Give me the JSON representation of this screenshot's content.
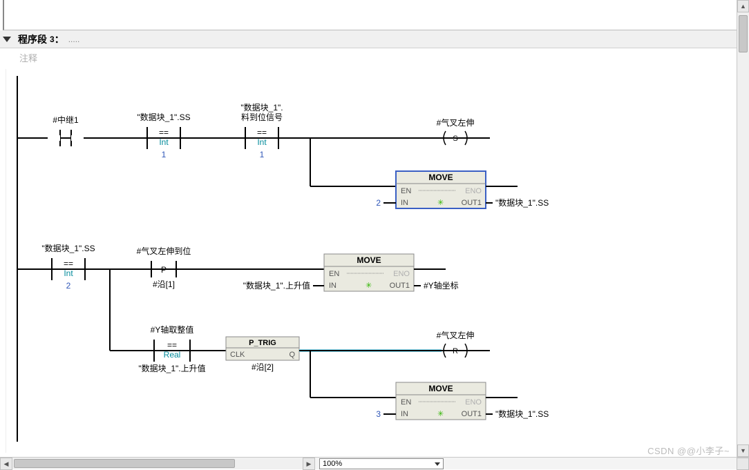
{
  "section": {
    "prefix": "程序段",
    "number": "3",
    "colon": "：",
    "dots": ".....",
    "comment_placeholder": "注释"
  },
  "rung1": {
    "contact1": "#中继1",
    "cmp1": {
      "top": "\"数据块_1\".SS",
      "type": "==",
      "datatype": "Int",
      "value": "1"
    },
    "cmp2": {
      "top_l1": "\"数据块_1\".",
      "top_l2": "料到位信号",
      "type": "==",
      "datatype": "Int",
      "value": "1"
    },
    "coil": {
      "label": "#气叉左伸",
      "letter": "S"
    },
    "move": {
      "title": "MOVE",
      "en": "EN",
      "eno": "ENO",
      "in": "IN",
      "out": "OUT1",
      "in_val": "2",
      "out_tag": "\"数据块_1\".SS"
    }
  },
  "rung2": {
    "cmp": {
      "top": "\"数据块_1\".SS",
      "type": "==",
      "datatype": "Int",
      "value": "2"
    },
    "pcontact": {
      "top": "#气叉左伸到位",
      "letter": "P",
      "bottom": "#沿[1]"
    },
    "move": {
      "title": "MOVE",
      "en": "EN",
      "eno": "ENO",
      "in": "IN",
      "out": "OUT1",
      "in_tag": "\"数据块_1\".上升值",
      "out_tag": "#Y轴坐标"
    }
  },
  "rung3": {
    "cmp_real": {
      "top": "#Y轴取整值",
      "type": "==",
      "datatype": "Real",
      "bottom": "\"数据块_1\".上升值"
    },
    "ptrig": {
      "title": "P_TRIG",
      "clk": "CLK",
      "q": "Q",
      "bottom": "#沿[2]"
    },
    "coil": {
      "label": "#气叉左伸",
      "letter": "R"
    },
    "move": {
      "title": "MOVE",
      "en": "EN",
      "eno": "ENO",
      "in": "IN",
      "out": "OUT1",
      "in_val": "3",
      "out_tag": "\"数据块_1\".SS"
    }
  },
  "zoom": "100%",
  "watermark": "CSDN @@小李子~"
}
